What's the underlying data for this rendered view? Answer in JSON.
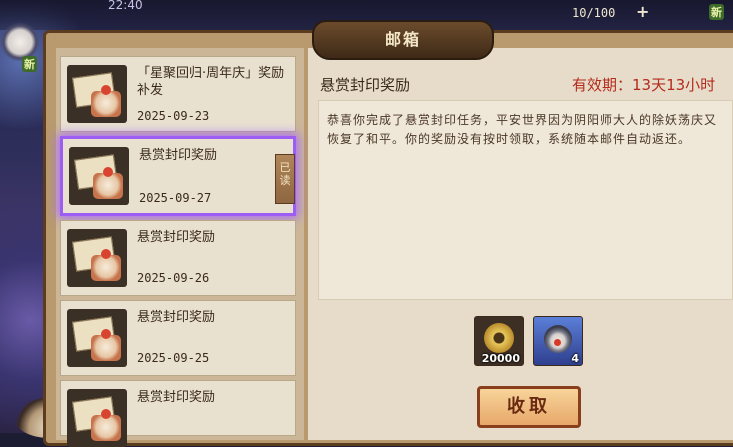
{
  "status_bar": {
    "time": "22:40",
    "count": "10/100",
    "plus": "+"
  },
  "badges": {
    "new_left": "新",
    "new_right": "新"
  },
  "window": {
    "title": "邮箱"
  },
  "mails": [
    {
      "title": "「星聚回归·周年庆」奖励补发",
      "date": "2025-09-23",
      "read_tag": ""
    },
    {
      "title": "悬赏封印奖励",
      "date": "2025-09-27",
      "read_tag": "已读",
      "selected": true
    },
    {
      "title": "悬赏封印奖励",
      "date": "2025-09-26",
      "read_tag": ""
    },
    {
      "title": "悬赏封印奖励",
      "date": "2025-09-25",
      "read_tag": ""
    },
    {
      "title": "悬赏封印奖励",
      "date": "",
      "read_tag": ""
    }
  ],
  "read_tag_chars": [
    "已",
    "读"
  ],
  "detail": {
    "title": "悬赏封印奖励",
    "expiry": "有效期：13天13小时",
    "body": "恭喜你完成了悬赏封印任务，平安世界因为阴阳师大人的除妖荡庆又恢复了和平。你的奖励没有按时领取，系统随本邮件自动返还。"
  },
  "rewards": [
    {
      "icon": "gold-coin-icon",
      "qty": "20000"
    },
    {
      "icon": "shikigami-icon",
      "qty": "4"
    }
  ],
  "claim_button": {
    "label": "收取"
  },
  "colors": {
    "accent_selected": "#9d5cf4",
    "expiry": "#b42b1c",
    "button": "#e8a86a"
  }
}
